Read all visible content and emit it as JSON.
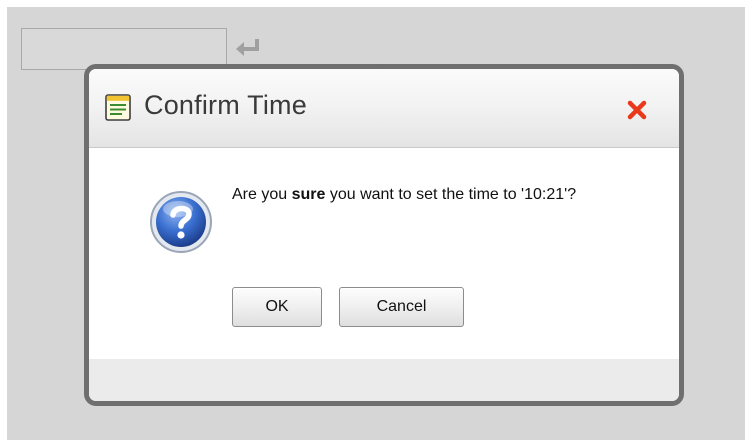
{
  "background_input": {
    "value": ""
  },
  "dialog": {
    "title": "Confirm Time",
    "message": {
      "prefix": "Are you ",
      "emphasis": "sure",
      "suffix": " you want to set the time to '10:21'?"
    },
    "buttons": {
      "ok_label": "OK",
      "cancel_label": "Cancel"
    },
    "icons": {
      "title": "form-icon",
      "close": "close-icon",
      "message": "question-icon",
      "input_action": "enter-arrow-icon"
    }
  },
  "colors": {
    "close_icon": "#e8391b",
    "question_icon": "#2e64c4",
    "dialog_border": "#6f6f6f",
    "backdrop": "#d6d6d6"
  }
}
